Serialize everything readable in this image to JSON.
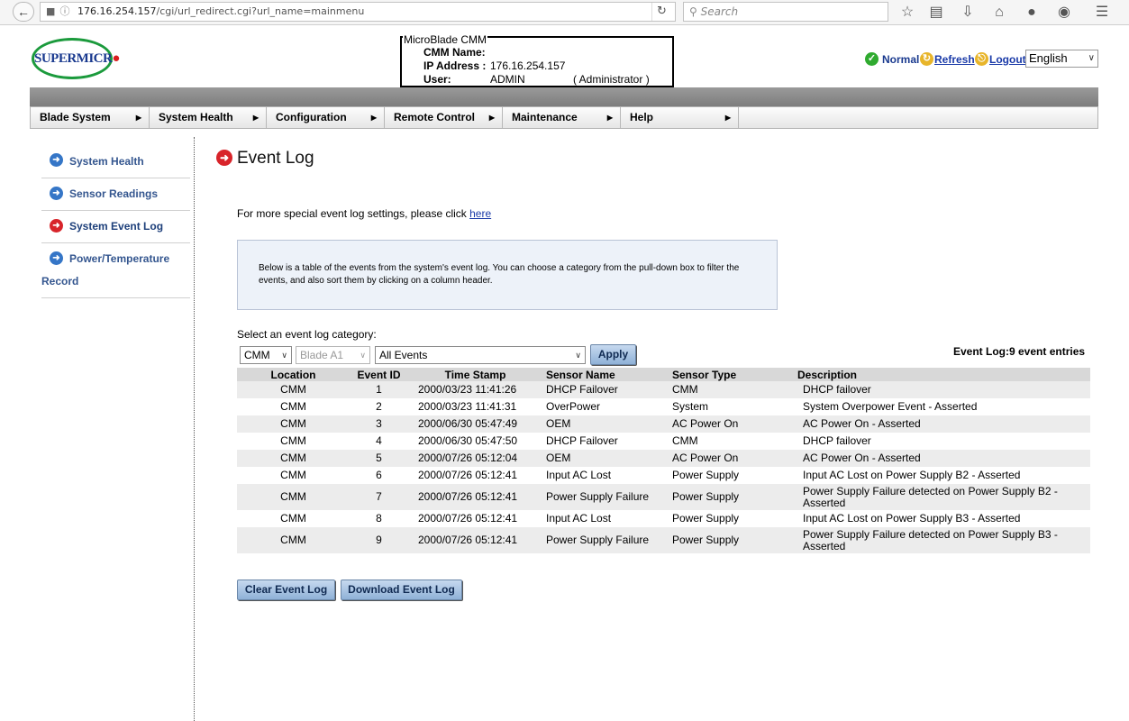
{
  "browser": {
    "url_host": "176.16.254.157",
    "url_path": "/cgi/url_redirect.cgi?url_name=mainmenu",
    "search_placeholder": "Search"
  },
  "header": {
    "logo_text": "SUPERMICR",
    "info_title": "MicroBlade CMM",
    "cmm_name_label": "CMM Name:",
    "cmm_name_value": "",
    "ip_label": "IP Address :",
    "ip_value": "176.16.254.157",
    "user_label": "User:",
    "user_value": "ADMIN",
    "user_role": "( Administrator )",
    "status_normal": "Normal",
    "refresh": "Refresh",
    "logout": "Logout",
    "language": "English"
  },
  "menu": {
    "items": [
      "Blade System",
      "System Health",
      "Configuration",
      "Remote Control",
      "Maintenance",
      "Help"
    ]
  },
  "sidebar": {
    "items": [
      "System Health",
      "Sensor Readings",
      "System Event Log",
      "Power/Temperature",
      "Record"
    ]
  },
  "main": {
    "title": "Event Log",
    "settings_text": "For more special event log settings, please click ",
    "settings_link": "here",
    "note": "Below is a table of the events from the system's event log. You can choose a category from the pull-down box to filter the events, and also sort them by clicking on a column header.",
    "select_label": "Select an event log category:",
    "select_location": "CMM",
    "select_blade": "Blade A1",
    "select_events": "All Events",
    "apply": "Apply",
    "entries": "Event Log:9 event entries",
    "clear_button": "Clear Event Log",
    "download_button": "Download Event Log"
  },
  "table": {
    "headers": [
      "Location",
      "Event ID",
      "Time Stamp",
      "Sensor Name",
      "Sensor Type",
      "Description"
    ],
    "rows": [
      [
        "CMM",
        "1",
        "2000/03/23 11:41:26",
        "DHCP Failover",
        "CMM",
        "DHCP failover"
      ],
      [
        "CMM",
        "2",
        "2000/03/23 11:41:31",
        "OverPower",
        "System",
        "System Overpower Event - Asserted"
      ],
      [
        "CMM",
        "3",
        "2000/06/30 05:47:49",
        "OEM",
        "AC Power On",
        "AC Power On - Asserted"
      ],
      [
        "CMM",
        "4",
        "2000/06/30 05:47:50",
        "DHCP Failover",
        "CMM",
        "DHCP failover"
      ],
      [
        "CMM",
        "5",
        "2000/07/26 05:12:04",
        "OEM",
        "AC Power On",
        "AC Power On - Asserted"
      ],
      [
        "CMM",
        "6",
        "2000/07/26 05:12:41",
        "Input AC Lost",
        "Power Supply",
        "Input AC Lost on Power Supply B2 - Asserted"
      ],
      [
        "CMM",
        "7",
        "2000/07/26 05:12:41",
        "Power Supply Failure",
        "Power Supply",
        "Power Supply Failure detected on Power Supply B2 - Asserted"
      ],
      [
        "CMM",
        "8",
        "2000/07/26 05:12:41",
        "Input AC Lost",
        "Power Supply",
        "Input AC Lost on Power Supply B3 - Asserted"
      ],
      [
        "CMM",
        "9",
        "2000/07/26 05:12:41",
        "Power Supply Failure",
        "Power Supply",
        "Power Supply Failure detected on Power Supply B3 - Asserted"
      ]
    ]
  },
  "colors": {
    "menu_text": "#000000",
    "sidebar_link": "#34568f",
    "active_icon": "#d8242a",
    "nav_icon": "#3576c7",
    "button_bg": "#a9c4e4"
  }
}
